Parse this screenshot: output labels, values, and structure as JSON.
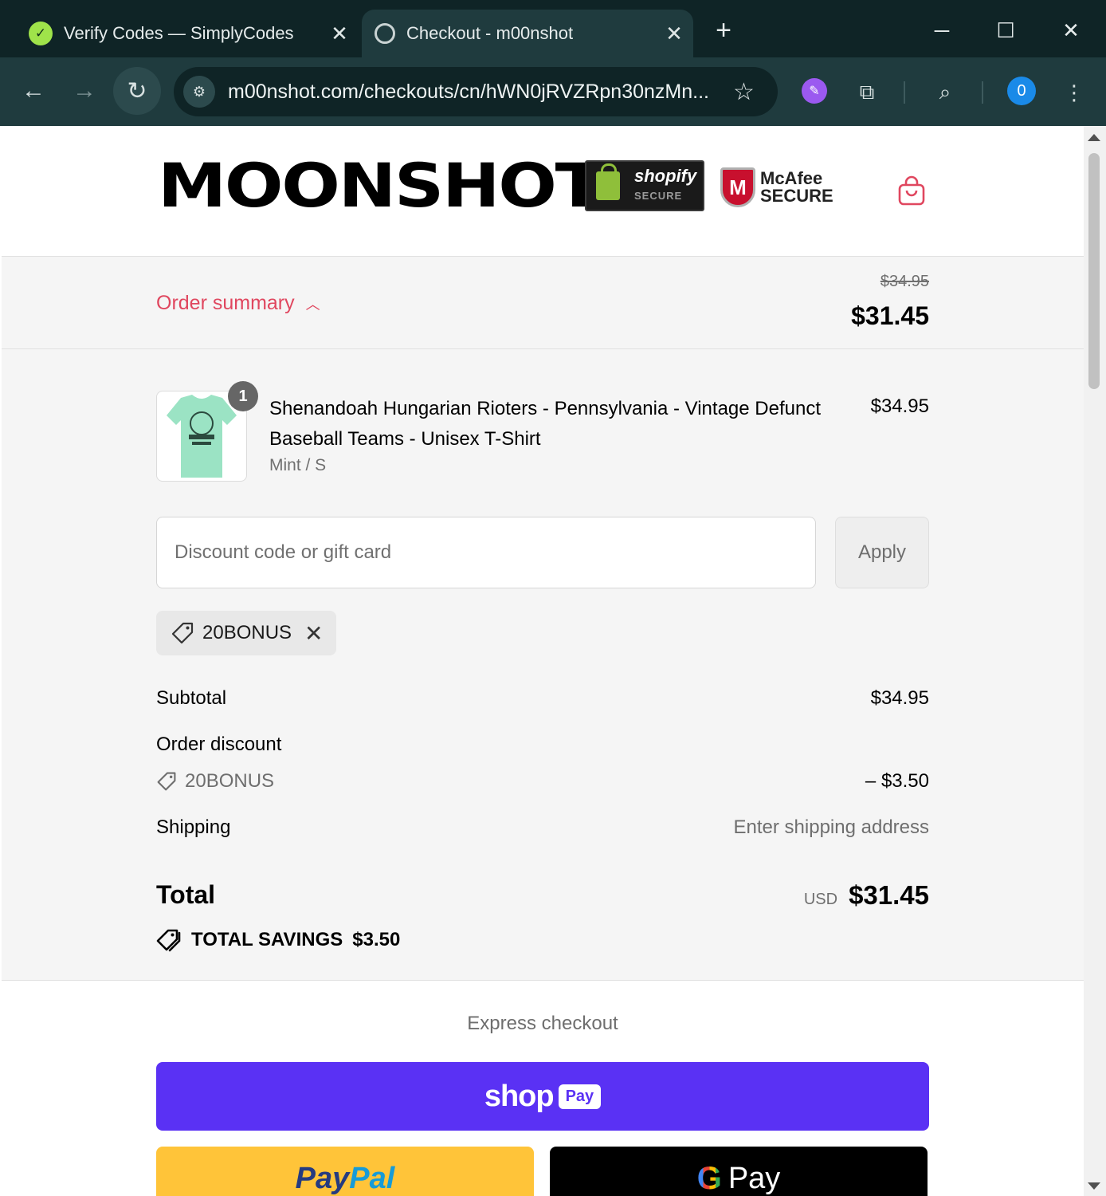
{
  "browser": {
    "tabs": [
      {
        "title": "Verify Codes — SimplyCodes",
        "favicon": "simplycodes-icon",
        "active": false
      },
      {
        "title": "Checkout - m00nshot",
        "favicon": "globe-icon",
        "active": true
      }
    ],
    "new_tab": "+",
    "url": "m00nshot.com/checkouts/cn/hWN0jRVZRpn30nzMn...",
    "profile_initial": "0"
  },
  "header": {
    "logo_text": "MOONSHOT",
    "shopify_badge": {
      "brand": "shopify",
      "sub": "SECURE"
    },
    "mcafee_badge": {
      "brand": "McAfee",
      "sub": "SECURE",
      "initial": "M"
    }
  },
  "summary": {
    "toggle_label": "Order summary",
    "original_price": "$34.95",
    "total": "$31.45"
  },
  "line_item": {
    "quantity": "1",
    "name": "Shenandoah Hungarian Rioters - Pennsylvania - Vintage Defunct Baseball Teams - Unisex T-Shirt",
    "variant": "Mint / S",
    "price": "$34.95"
  },
  "discount": {
    "placeholder": "Discount code or gift card",
    "apply_label": "Apply",
    "applied_code": "20BONUS"
  },
  "totals": {
    "subtotal_label": "Subtotal",
    "subtotal_value": "$34.95",
    "order_discount_label": "Order discount",
    "discount_code": "20BONUS",
    "discount_value": "– $3.50",
    "shipping_label": "Shipping",
    "shipping_value": "Enter shipping address",
    "total_label": "Total",
    "currency": "USD",
    "total_value": "$31.45",
    "savings_label": "TOTAL SAVINGS",
    "savings_value": "$3.50"
  },
  "express": {
    "title": "Express checkout",
    "shoppay_word": "shop",
    "shoppay_pill": "Pay",
    "paypal_1": "Pay",
    "paypal_2": "Pal",
    "gpay_g": "G",
    "gpay_word": "Pay"
  },
  "colors": {
    "accent": "#e0475f",
    "shoppay": "#5a31f4",
    "paypal": "#ffc439",
    "chrome_dark": "#0f2426",
    "chrome_toolbar": "#1f3b3e"
  }
}
